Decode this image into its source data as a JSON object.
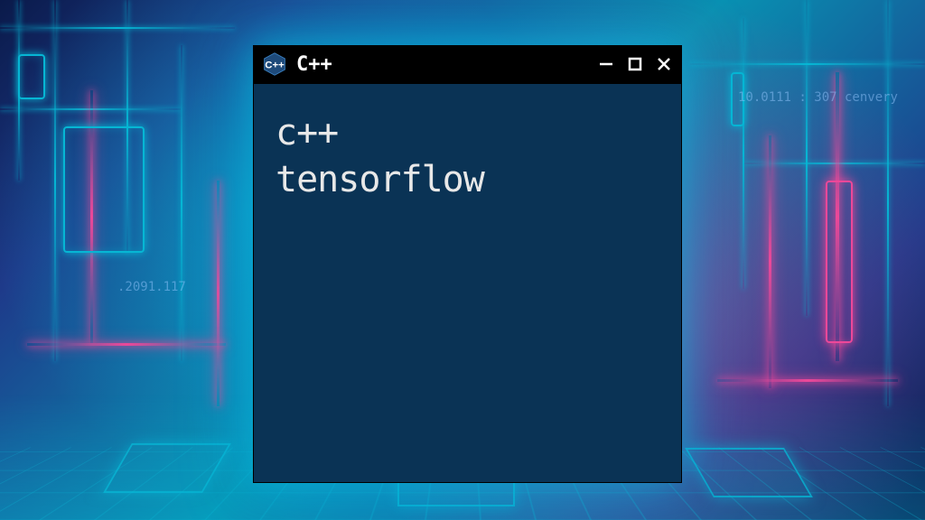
{
  "window": {
    "title": "C++",
    "icon_label": "C++"
  },
  "content": {
    "line1": "c++",
    "line2": "tensorflow"
  },
  "bg_text": {
    "right_top": "10.0111 : 307  cenvery",
    "left_mid": ".2091.117"
  }
}
